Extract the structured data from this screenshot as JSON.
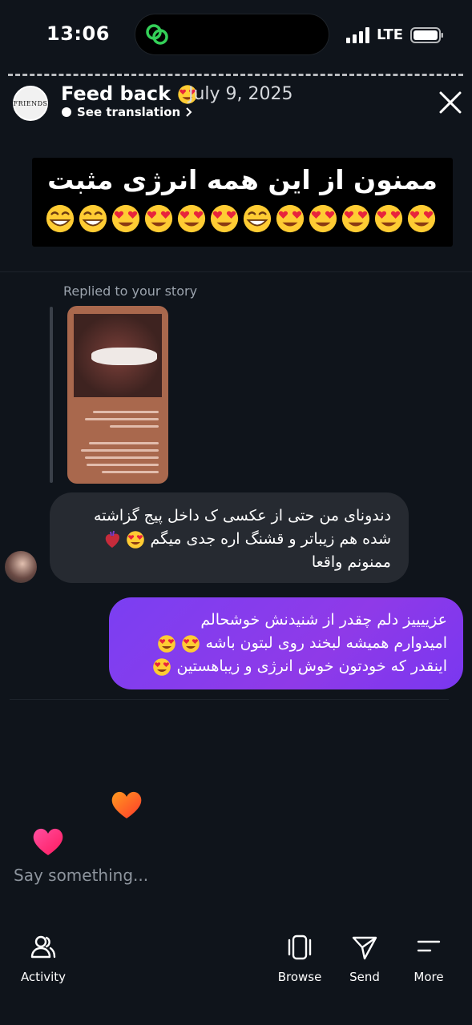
{
  "status_bar": {
    "time": "13:06",
    "network": "LTE"
  },
  "header": {
    "avatar_text": "FRIENDS",
    "title": "Feed back",
    "title_emoji": "heart-eyes-emoji",
    "date": "July 9, 2025",
    "see_translation": "See translation"
  },
  "story": {
    "text": "ممنون از این همه انرژی مثبت",
    "emojis": [
      "grin",
      "grin",
      "heart-eyes",
      "heart-eyes",
      "heart-eyes",
      "heart-eyes",
      "grin",
      "heart-eyes",
      "heart-eyes",
      "heart-eyes",
      "heart-eyes",
      "heart-eyes"
    ]
  },
  "reply": {
    "label": "Replied to your story"
  },
  "messages": {
    "incoming": {
      "line1": "دندونای من حتی از عکسی ک داخل پیج گزاشته",
      "line2": "شده هم زیباتر و قشنگ اره جدی میگم",
      "line3": "ممنونم واقعا"
    },
    "outgoing": {
      "line1": "عزییییز دلم چقدر از شنیدنش خوشحالم",
      "line2": "امیدوارم همیشه لبخند روی لبتون باشه",
      "line3": "اینقدر که خودتون خوش انرژی و زیباهستین"
    }
  },
  "composer": {
    "placeholder": "Say something..."
  },
  "nav": {
    "activity": "Activity",
    "browse": "Browse",
    "send": "Send",
    "more": "More"
  }
}
